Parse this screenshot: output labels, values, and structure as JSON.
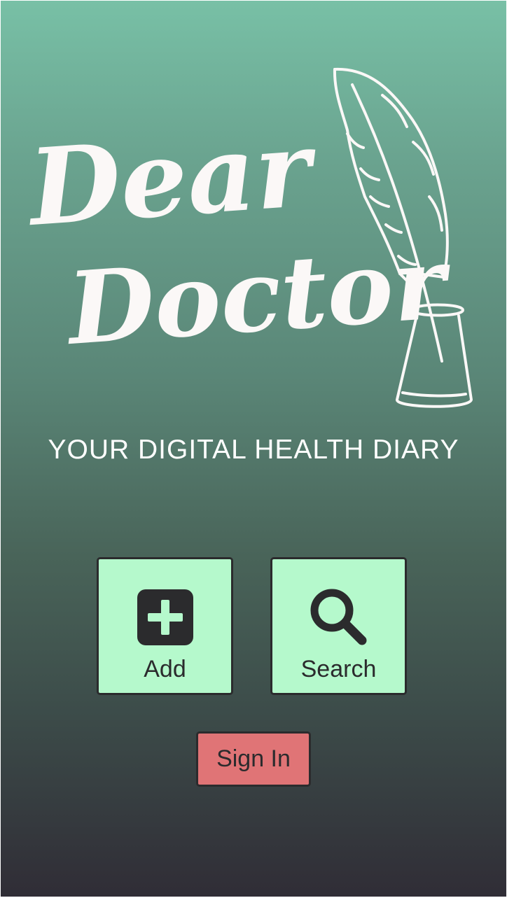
{
  "app": {
    "logo_line1": "Dear",
    "logo_line2": "Doctor",
    "tagline": "YOUR DIGITAL HEALTH DIARY"
  },
  "actions": {
    "add_label": "Add",
    "search_label": "Search",
    "signin_label": "Sign In"
  },
  "icons": {
    "add": "plus-square-icon",
    "search": "magnifier-icon",
    "logo": "quill-and-inkwell-icon"
  },
  "colors": {
    "tile_bg": "#b5f9cc",
    "signin_bg": "#e07476",
    "dark": "#2b2b2d",
    "gradient_top": "#78c0a6",
    "gradient_bottom": "#302d36"
  }
}
